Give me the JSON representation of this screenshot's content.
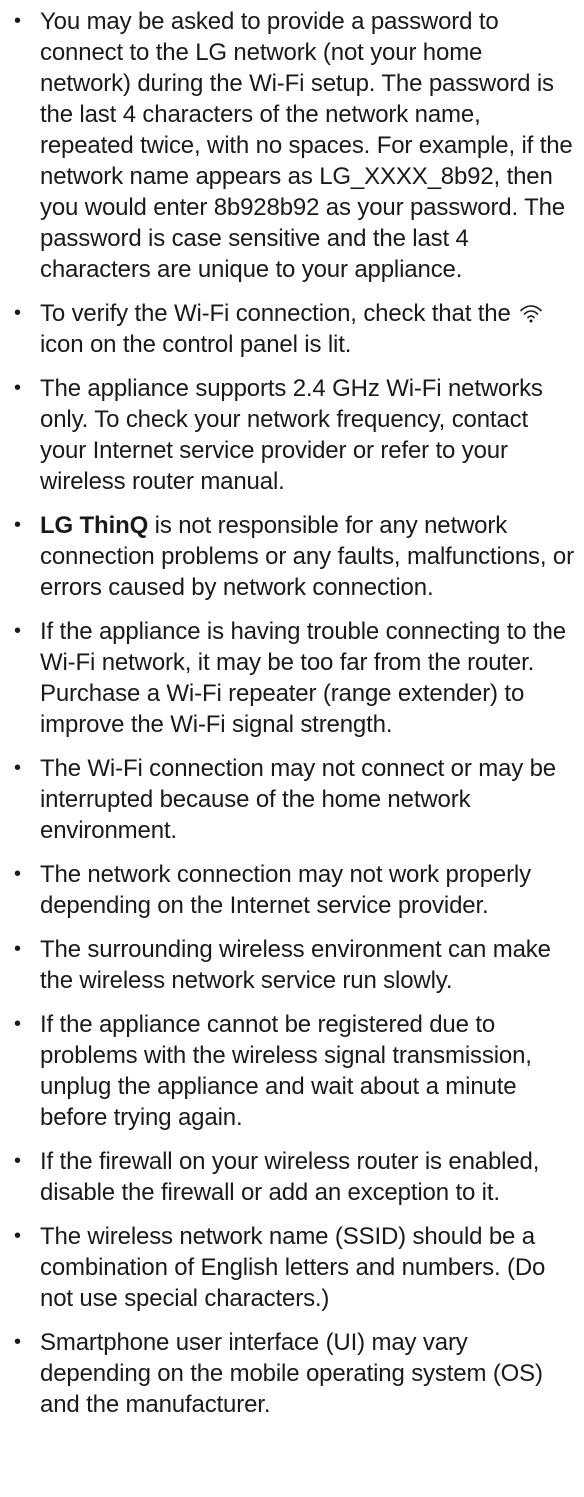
{
  "bullet": "•",
  "items": [
    {
      "text": "You may be asked to provide a password to connect to the LG network (not your home network) during the Wi-Fi setup. The password is the last 4 characters of the network name, repeated twice, with no spaces. For example, if the network name appears as LG_XXXX_8b92, then you would enter 8b928b92 as your password. The password is case sensitive and the last 4 characters are unique to your appliance."
    },
    {
      "text_before": "To verify the Wi-Fi connection, check that the",
      "icon": "wifi-icon",
      "text_after": "icon on the control panel is lit."
    },
    {
      "text": "The appliance supports 2.4 GHz Wi-Fi networks only. To check your network frequency, contact your Internet service provider or refer to your wireless router manual."
    },
    {
      "bold": "LG ThinQ",
      "text": " is not responsible for any network connection problems or any faults, malfunctions, or errors caused by network connection."
    },
    {
      "text": "If the appliance is having trouble connecting to the Wi-Fi network, it may be too far from the router. Purchase a Wi-Fi repeater (range extender) to improve the Wi-Fi signal strength."
    },
    {
      "text": "The Wi-Fi connection may not connect or may be interrupted because of the home network environment."
    },
    {
      "text": "The network connection may not work properly depending on the Internet service provider."
    },
    {
      "text": "The surrounding wireless environment can make the wireless network service run slowly."
    },
    {
      "text": "If the appliance cannot be registered due to problems with the wireless signal transmission, unplug the appliance and wait about a minute before trying again."
    },
    {
      "text": "If the firewall on your wireless router is enabled, disable the firewall or add an exception to it."
    },
    {
      "text": "The wireless network name (SSID) should be a combination of English letters and numbers. (Do not use special characters.)"
    },
    {
      "text": "Smartphone user interface (UI) may vary depending on the mobile operating system (OS) and the manufacturer."
    }
  ]
}
